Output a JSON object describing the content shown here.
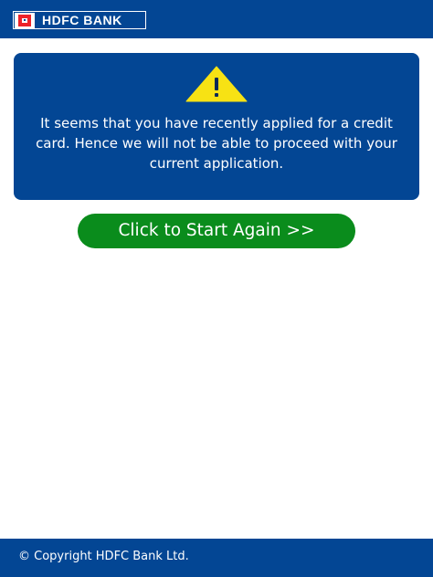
{
  "header": {
    "brand_name": "HDFC BANK",
    "logo_icon": "hdfc-bank-logo-icon"
  },
  "alert": {
    "icon": "warning-icon",
    "message": "It seems that you have recently applied for a credit card. Hence we will not be able to proceed with your current application."
  },
  "actions": {
    "restart_label": "Click to Start Again >>"
  },
  "footer": {
    "copyright": "© Copyright HDFC Bank Ltd."
  },
  "colors": {
    "brand_blue": "#034694",
    "brand_red": "#ed232a",
    "button_green": "#0a8c1c",
    "warning_yellow": "#f7e214"
  }
}
